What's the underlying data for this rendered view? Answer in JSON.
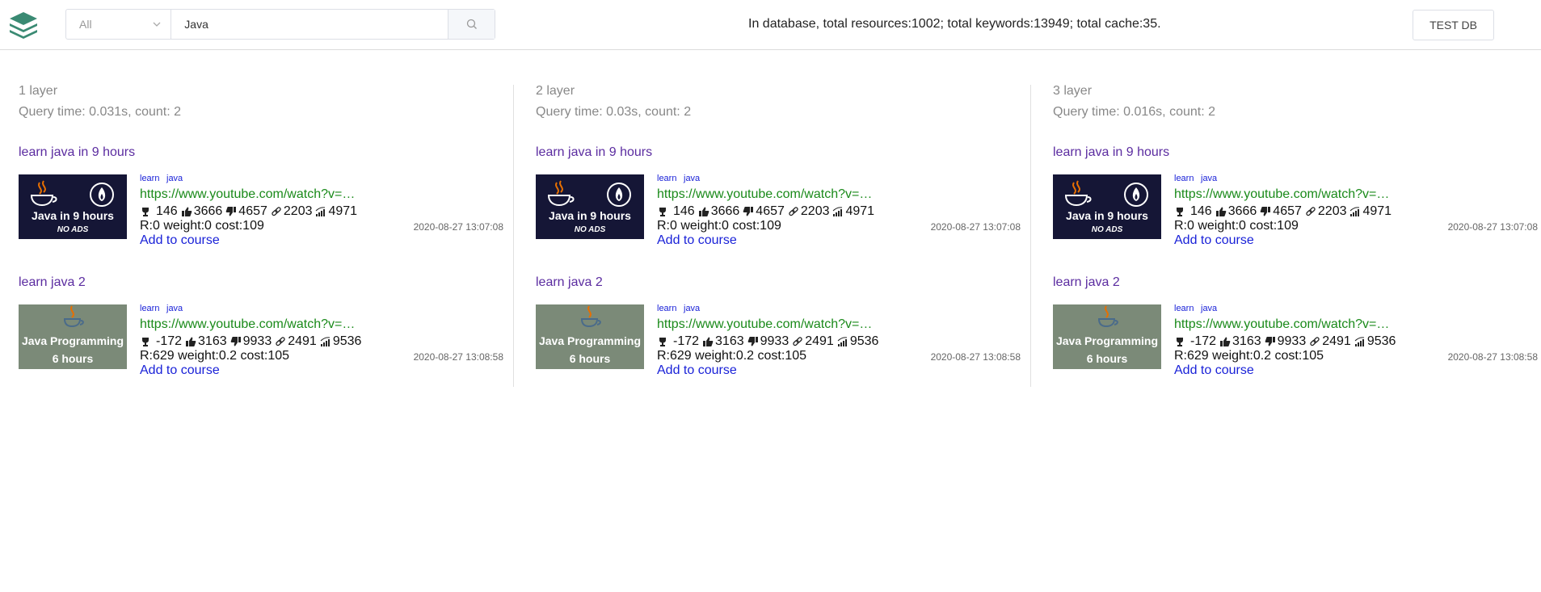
{
  "header": {
    "category_select": "All",
    "search_value": "Java",
    "stats_text": "In database, total resources:1002; total keywords:13949; total cache:35.",
    "test_db_label": "TEST DB"
  },
  "thumbs": {
    "t1": {
      "line1": "Java in 9 hours",
      "line2": "NO ADS"
    },
    "t2": {
      "line1": "Java Programming",
      "line2": "6 hours"
    }
  },
  "columns": [
    {
      "layer": "1 layer",
      "query": "Query time: 0.031s, count: 2",
      "results": [
        {
          "title": "learn java in 9 hours",
          "kw1": "learn",
          "kw2": "java",
          "url": "https://www.youtube.com/watch?v=…",
          "rank": "146",
          "likes": "3666",
          "dislikes": "4657",
          "links": "2203",
          "views": "4971",
          "rwc": "R:0 weight:0 cost:109",
          "date": "2020-08-27 13:07:08",
          "add": "Add to course"
        },
        {
          "title": "learn java 2",
          "kw1": "learn",
          "kw2": "java",
          "url": "https://www.youtube.com/watch?v=…",
          "rank": "-172",
          "likes": "3163",
          "dislikes": "9933",
          "links": "2491",
          "views": "9536",
          "rwc": "R:629 weight:0.2 cost:105",
          "date": "2020-08-27 13:08:58",
          "add": "Add to course"
        }
      ]
    },
    {
      "layer": "2 layer",
      "query": "Query time: 0.03s, count: 2",
      "results": [
        {
          "title": "learn java in 9 hours",
          "kw1": "learn",
          "kw2": "java",
          "url": "https://www.youtube.com/watch?v=…",
          "rank": "146",
          "likes": "3666",
          "dislikes": "4657",
          "links": "2203",
          "views": "4971",
          "rwc": "R:0 weight:0 cost:109",
          "date": "2020-08-27 13:07:08",
          "add": "Add to course"
        },
        {
          "title": "learn java 2",
          "kw1": "learn",
          "kw2": "java",
          "url": "https://www.youtube.com/watch?v=…",
          "rank": "-172",
          "likes": "3163",
          "dislikes": "9933",
          "links": "2491",
          "views": "9536",
          "rwc": "R:629 weight:0.2 cost:105",
          "date": "2020-08-27 13:08:58",
          "add": "Add to course"
        }
      ]
    },
    {
      "layer": "3 layer",
      "query": "Query time: 0.016s, count: 2",
      "results": [
        {
          "title": "learn java in 9 hours",
          "kw1": "learn",
          "kw2": "java",
          "url": "https://www.youtube.com/watch?v=…",
          "rank": "146",
          "likes": "3666",
          "dislikes": "4657",
          "links": "2203",
          "views": "4971",
          "rwc": "R:0 weight:0 cost:109",
          "date": "2020-08-27 13:07:08",
          "add": "Add to course"
        },
        {
          "title": "learn java 2",
          "kw1": "learn",
          "kw2": "java",
          "url": "https://www.youtube.com/watch?v=…",
          "rank": "-172",
          "likes": "3163",
          "dislikes": "9933",
          "links": "2491",
          "views": "9536",
          "rwc": "R:629 weight:0.2 cost:105",
          "date": "2020-08-27 13:08:58",
          "add": "Add to course"
        }
      ]
    }
  ]
}
